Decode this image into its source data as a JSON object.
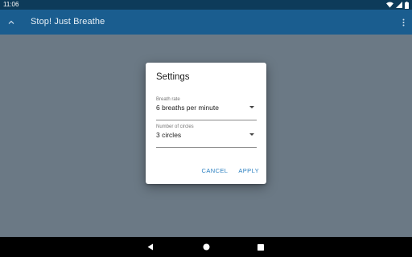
{
  "status_bar": {
    "time": "11:06",
    "icons": [
      "wifi-icon",
      "cell-signal-icon",
      "battery-icon"
    ]
  },
  "app_bar": {
    "title": "Stop! Just Breathe",
    "collapse_icon": "chevron-up-icon",
    "overflow_icon": "more-vert-icon"
  },
  "dialog": {
    "title": "Settings",
    "fields": {
      "breath_rate": {
        "label": "Breath rate",
        "value": "6 breaths per minute"
      },
      "circles": {
        "label": "Number of circles",
        "value": "3 circles"
      }
    },
    "actions": {
      "cancel": "CANCEL",
      "apply": "APPLY"
    }
  },
  "nav_bar": {
    "icons": [
      "back-icon",
      "home-icon",
      "recents-icon"
    ]
  },
  "colors": {
    "status_bar": "#0d3b5a",
    "app_bar": "#1a5d8f",
    "scrim_background": "#6b7985",
    "accent": "#2a7fc0",
    "nav_bar": "#000000"
  }
}
